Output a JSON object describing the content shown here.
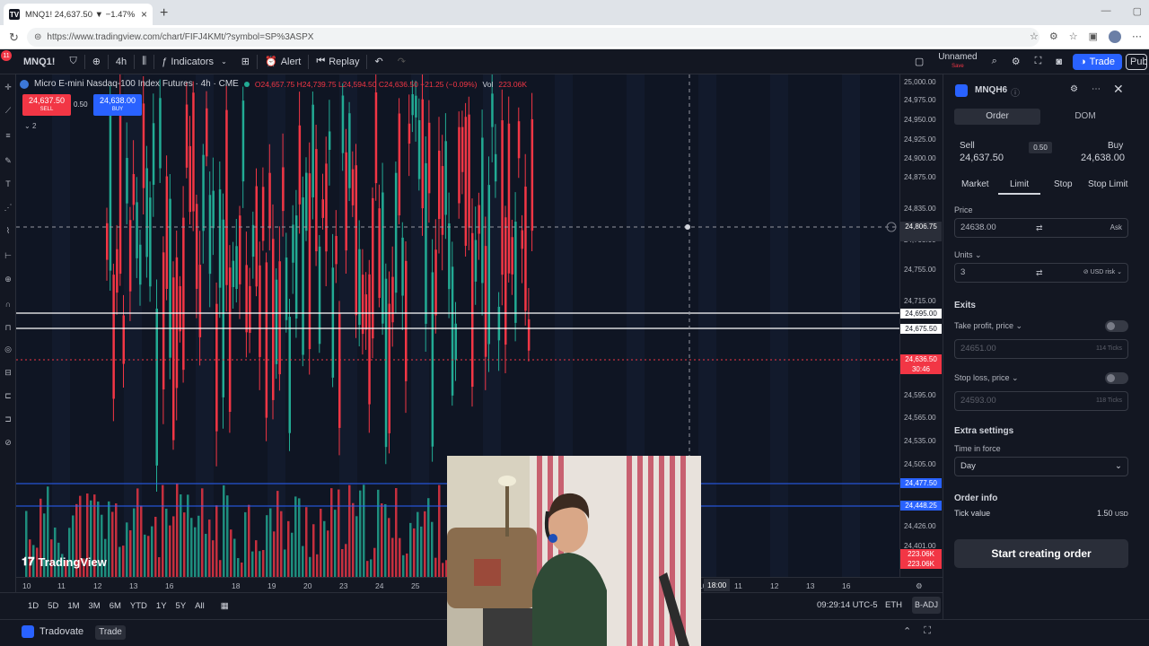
{
  "browser": {
    "tab_title": "MNQ1! 24,637.50 ▼ −1.47% Unna",
    "url": "https://www.tradingview.com/chart/FIFJ4KMt/?symbol=SP%3ASPX"
  },
  "toolbar": {
    "notif_count": "11",
    "symbol": "MNQ1!",
    "interval": "4h",
    "indicators": "Indicators",
    "alert": "Alert",
    "replay": "Replay",
    "layout_name": "Unnamed",
    "layout_sub": "Save",
    "trade": "Trade",
    "publish": "Publ"
  },
  "chart": {
    "title": "Micro E-mini Nasdaq-100 Index Futures · 4h · CME",
    "ohlc": "O24,657.75 H24,739.75 L24,594.50 C24,636.50 −21.25 (−0.09%)",
    "vol_label": "Vol",
    "vol_value": "223.06K",
    "sell_price": "24,637.50",
    "sell_label": "SELL",
    "spread": "0.50",
    "buy_price": "24,638.00",
    "buy_label": "BUY",
    "collapse": "2",
    "watermark": "TradingView"
  },
  "price_axis": {
    "labels": [
      "25,000.00",
      "24,975.00",
      "24,950.00",
      "24,925.00",
      "24,900.00",
      "24,875.00",
      "24,835.00",
      "24,795.00",
      "24,755.00",
      "24,715.00",
      "24,595.00",
      "24,565.00",
      "24,535.00",
      "24,505.00",
      "24,426.00",
      "24,401.00"
    ],
    "crosshair": "24,806.75",
    "level1": "24,695.00",
    "level2": "24,675.50",
    "last_price": "24,636.50",
    "countdown": "30:46",
    "blue1": "24,477.50",
    "blue2": "24,448.25",
    "vol1": "223.06K",
    "vol2": "223.06K"
  },
  "time_axis": {
    "labels": [
      "10",
      "11",
      "12",
      "13",
      "16",
      "18",
      "19",
      "20",
      "23",
      "24",
      "25",
      "10",
      "11",
      "12",
      "13",
      "16"
    ],
    "crosshair": "18:00"
  },
  "bottom": {
    "ranges": [
      "1D",
      "5D",
      "1M",
      "3M",
      "6M",
      "YTD",
      "1Y",
      "5Y",
      "All"
    ],
    "clock": "09:29:14 UTC-5",
    "session": "ETH",
    "adj": "B-ADJ",
    "broker": "Tradovate",
    "trade": "Trade"
  },
  "panel": {
    "symbol": "MNQH6",
    "tabs": [
      "Order",
      "DOM"
    ],
    "sell_label": "Sell",
    "sell_price": "24,637.50",
    "spread": "0.50",
    "buy_label": "Buy",
    "buy_price": "24,638.00",
    "order_types": [
      "Market",
      "Limit",
      "Stop",
      "Stop Limit"
    ],
    "price_label": "Price",
    "price_value": "24638.00",
    "price_suffix": "Ask",
    "units_label": "Units",
    "units_value": "3",
    "units_suffix": "USD risk",
    "exits": "Exits",
    "tp_label": "Take profit, price",
    "tp_value": "24651.00",
    "tp_ticks": "114 Ticks",
    "sl_label": "Stop loss, price",
    "sl_value": "24593.00",
    "sl_ticks": "118 Ticks",
    "extra": "Extra settings",
    "tif_label": "Time in force",
    "tif_value": "Day",
    "order_info": "Order info",
    "tick_label": "Tick value",
    "tick_value": "1.50",
    "tick_unit": "USD",
    "start": "Start creating order"
  },
  "colors": {
    "up": "#22ab94",
    "down": "#f23645",
    "accent": "#2962ff",
    "bg": "#0f1523"
  }
}
